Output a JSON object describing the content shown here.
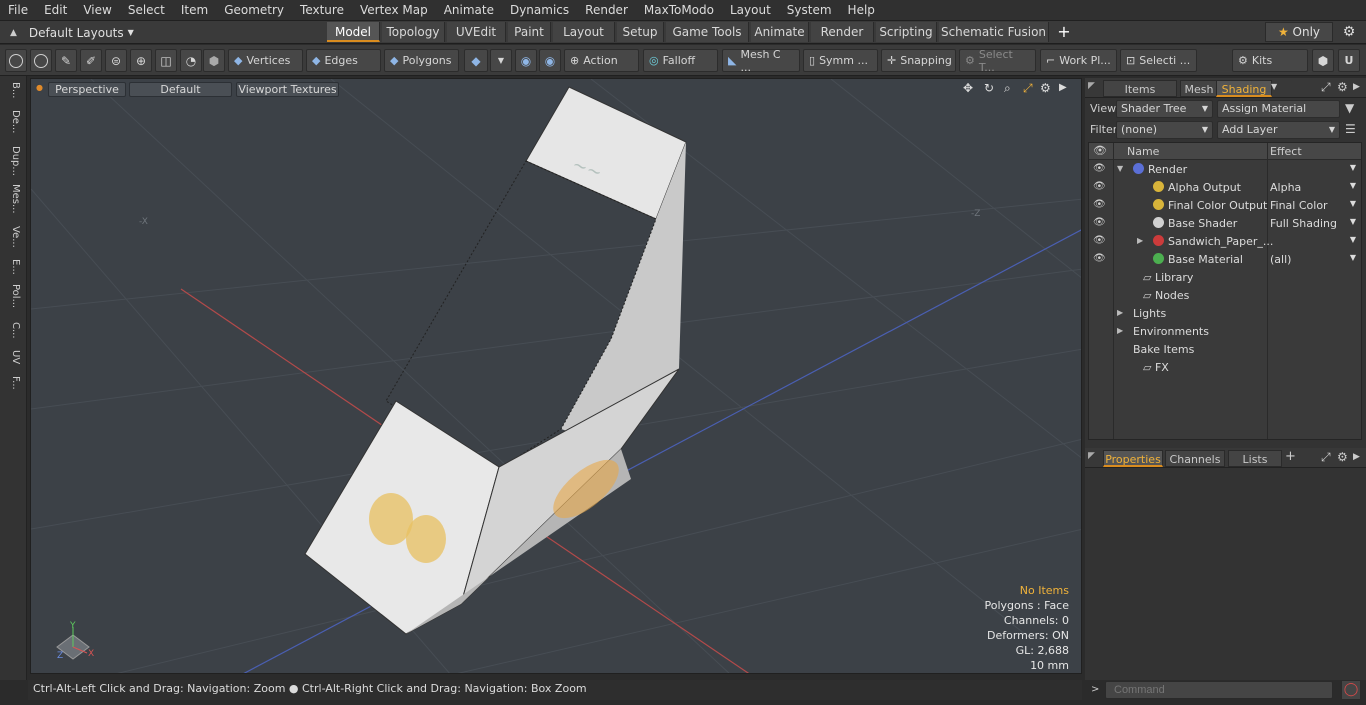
{
  "menubar": [
    "File",
    "Edit",
    "View",
    "Select",
    "Item",
    "Geometry",
    "Texture",
    "Vertex Map",
    "Animate",
    "Dynamics",
    "Render",
    "MaxToModo",
    "Layout",
    "System",
    "Help"
  ],
  "layout_dropdown": "Default Layouts",
  "mode_tabs": [
    {
      "label": "Model",
      "active": true
    },
    {
      "label": "Topology",
      "active": false
    },
    {
      "label": "UVEdit",
      "active": false
    },
    {
      "label": "Paint",
      "active": false
    },
    {
      "label": "Layout",
      "active": false
    },
    {
      "label": "Setup",
      "active": false
    },
    {
      "label": "Game Tools",
      "active": false
    },
    {
      "label": "Animate",
      "active": false
    },
    {
      "label": "Render",
      "active": false
    },
    {
      "label": "Scripting",
      "active": false
    },
    {
      "label": "Schematic Fusion",
      "active": false
    }
  ],
  "only_label": "Only",
  "toolbar": {
    "vertices": "Vertices",
    "edges": "Edges",
    "polygons": "Polygons",
    "action": "Action",
    "falloff": "Falloff",
    "mesh": "Mesh C ...",
    "symm": "Symm ...",
    "snapping": "Snapping",
    "select_t": "Select T...",
    "work_pl": "Work Pl...",
    "selecti": "Selecti ...",
    "kits": "Kits"
  },
  "left_tabs": [
    "B...",
    "De...",
    "Dup...",
    "Mes...",
    "Ve...",
    "E...",
    "Pol...",
    "C...",
    "UV",
    "F..."
  ],
  "viewport": {
    "perspective": "Perspective",
    "default": "Default",
    "textures": "Viewport Textures",
    "hud": {
      "items": "No Items",
      "polygons": "Polygons : Face",
      "channels": "Channels: 0",
      "deformers": "Deformers: ON",
      "gl": "GL: 2,688",
      "unit": "10 mm"
    },
    "axis_x": "X",
    "axis_y": "Y",
    "axis_z": "Z",
    "neg_x": "-X",
    "neg_z": "-Z"
  },
  "status": "Ctrl-Alt-Left Click and Drag: Navigation: Zoom ● Ctrl-Alt-Right Click and Drag: Navigation: Box Zoom",
  "right_tabs": [
    {
      "label": "Items",
      "active": false
    },
    {
      "label": "Mesh ...",
      "active": false
    },
    {
      "label": "Shading",
      "active": true
    }
  ],
  "shading": {
    "view_label": "View",
    "view_value": "Shader Tree",
    "assign": "Assign Material",
    "filter_label": "Filter",
    "filter_value": "(none)",
    "add_layer": "Add Layer",
    "col_name": "Name",
    "col_effect": "Effect",
    "rows": [
      {
        "name": "Render",
        "effect": "",
        "indent": 1,
        "eye": true,
        "swatch": "#5b6fd6",
        "expand": "▼"
      },
      {
        "name": "Alpha Output",
        "effect": "Alpha",
        "indent": 3,
        "eye": true,
        "swatch": "#d8b43a",
        "expand": ""
      },
      {
        "name": "Final Color Output",
        "effect": "Final Color",
        "indent": 3,
        "eye": true,
        "swatch": "#d8b43a",
        "expand": ""
      },
      {
        "name": "Base Shader",
        "effect": "Full Shading",
        "indent": 3,
        "eye": true,
        "swatch": "#d0d0d0",
        "expand": ""
      },
      {
        "name": "Sandwich_Paper_...",
        "effect": "",
        "indent": 3,
        "eye": true,
        "swatch": "#cc3b3b",
        "expand": "▶"
      },
      {
        "name": "Base Material",
        "effect": "(all)",
        "indent": 3,
        "eye": true,
        "swatch": "#4caf50",
        "expand": ""
      },
      {
        "name": "Library",
        "effect": "",
        "indent": 2,
        "eye": false,
        "swatch": "",
        "expand": ""
      },
      {
        "name": "Nodes",
        "effect": "",
        "indent": 2,
        "eye": false,
        "swatch": "",
        "expand": ""
      },
      {
        "name": "Lights",
        "effect": "",
        "indent": 1,
        "eye": false,
        "swatch": "",
        "expand": "▶"
      },
      {
        "name": "Environments",
        "effect": "",
        "indent": 1,
        "eye": false,
        "swatch": "",
        "expand": "▶"
      },
      {
        "name": "Bake Items",
        "effect": "",
        "indent": 1,
        "eye": false,
        "swatch": "",
        "expand": ""
      },
      {
        "name": "FX",
        "effect": "",
        "indent": 2,
        "eye": false,
        "swatch": "",
        "expand": ""
      }
    ]
  },
  "props_tabs": [
    {
      "label": "Properties",
      "active": true
    },
    {
      "label": "Channels",
      "active": false
    },
    {
      "label": "Lists",
      "active": false
    }
  ],
  "command_placeholder": "Command"
}
